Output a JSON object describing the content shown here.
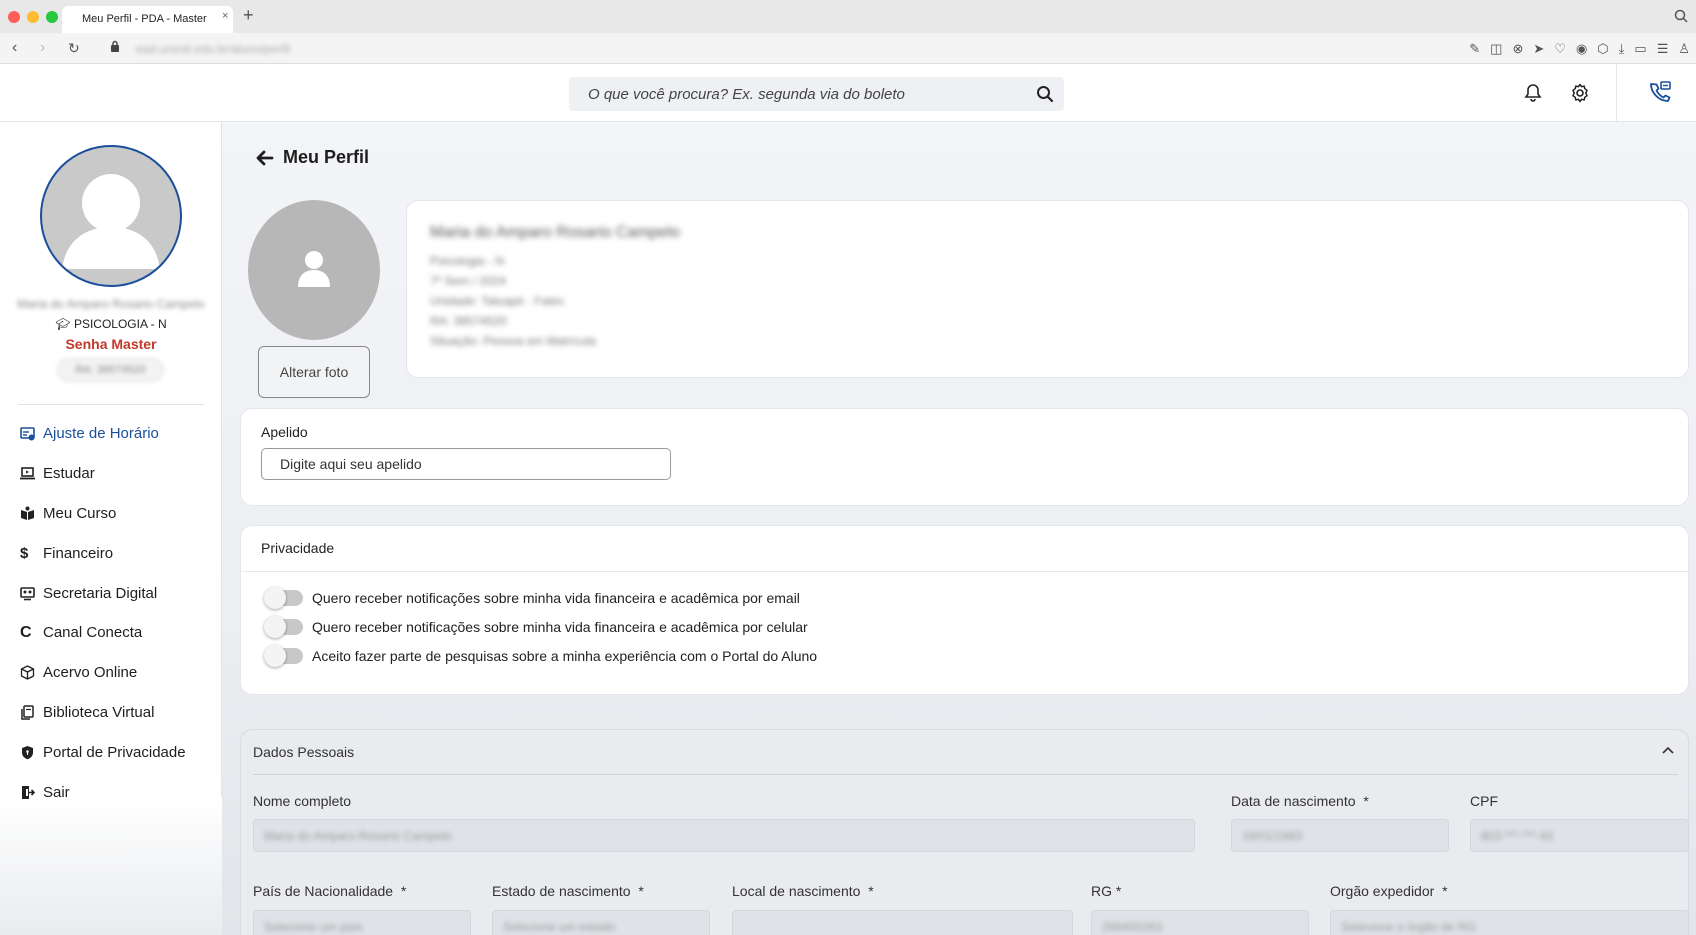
{
  "browser": {
    "tab_title": "Meu Perfil - PDA - Master",
    "tab_close": "×",
    "new_tab": "+",
    "url": "ead.unicid.edu.br/aluno/perfil",
    "nav_back": "‹",
    "nav_forward": "›",
    "nav_reload": "↻"
  },
  "header": {
    "search_placeholder": "O que você procura? Ex. segunda via do boleto"
  },
  "sidebar": {
    "user_name": "Maria do Amparo Rosario Campelo",
    "course": "PSICOLOGIA - N",
    "password_label": "Senha Master",
    "student_id": "RA: 38574520",
    "items": [
      {
        "label": "Ajuste de Horário",
        "icon": "calendar-icon"
      },
      {
        "label": "Estudar",
        "icon": "laptop-icon"
      },
      {
        "label": "Meu Curso",
        "icon": "book-open-icon"
      },
      {
        "label": "Financeiro",
        "icon": "dollar-icon"
      },
      {
        "label": "Secretaria Digital",
        "icon": "computer-users-icon"
      },
      {
        "label": "Canal Conecta",
        "icon": "conecta-icon"
      },
      {
        "label": "Acervo Online",
        "icon": "cube-icon"
      },
      {
        "label": "Biblioteca Virtual",
        "icon": "books-icon"
      },
      {
        "label": "Portal de Privacidade",
        "icon": "shield-icon"
      },
      {
        "label": "Sair",
        "icon": "logout-icon"
      }
    ]
  },
  "main": {
    "page_title": "Meu Perfil",
    "change_photo_button": "Alterar foto",
    "profile": {
      "name": "Maria do Amparo Rosario Campelo",
      "course_line": "Psicologia - N",
      "period_line": "7º Sem / 2024",
      "unit_line": "Unidade: Tatuapé - Fatec",
      "ra_line": "RA: 38574520",
      "status_line": "Situação: Pessoa em Matrícula"
    },
    "nickname": {
      "label": "Apelido",
      "placeholder": "Digite aqui seu apelido"
    },
    "privacy": {
      "title": "Privacidade",
      "options": [
        "Quero receber notificações sobre minha vida financeira e acadêmica por email",
        "Quero receber notificações sobre minha vida financeira e acadêmica por celular",
        "Aceito fazer parte de pesquisas sobre a minha experiência com o Portal do Aluno"
      ],
      "states": [
        false,
        false,
        false
      ]
    },
    "personal": {
      "title": "Dados Pessoais",
      "full_name_label": "Nome completo",
      "full_name_value": "Maria do Amparo Rosario Campelo",
      "birth_label": "Data de nascimento",
      "birth_value": "19/01/1983",
      "cpf_label": "CPF",
      "cpf_value": "803.***.***-43",
      "nationality_label": "País de Nacionalidade",
      "nationality_value": "Selecione um país",
      "birth_state_label": "Estado de nascimento",
      "birth_state_value": "Selecione um estado",
      "birth_place_label": "Local de nascimento",
      "birth_place_value": "",
      "rg_label": "RG",
      "rg_value": "268455263",
      "issuer_label": "Orgão expedidor",
      "issuer_value": "Selecione o órgão de RG",
      "required_mark": "*"
    }
  },
  "colors": {
    "accent": "#1a4f9c",
    "password": "#c0392b",
    "toggle_off": "#c8c8c8"
  }
}
